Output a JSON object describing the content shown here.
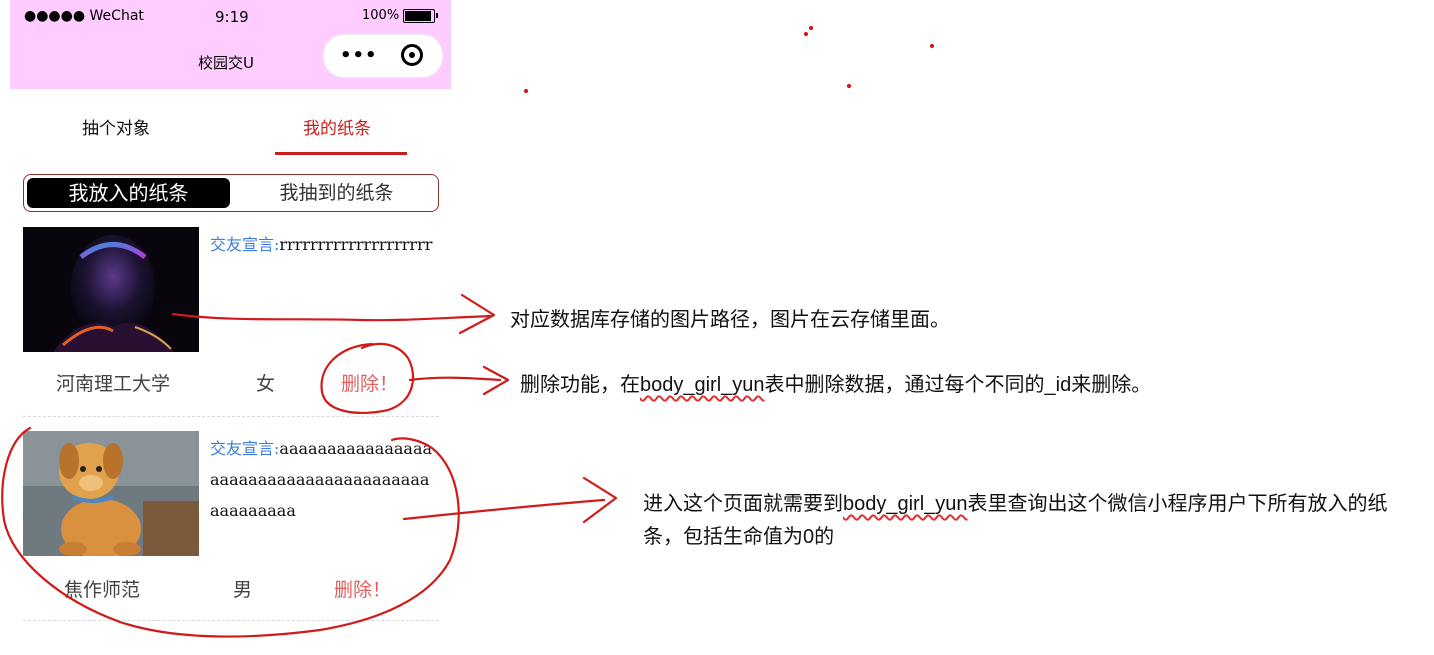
{
  "status": {
    "carrier": "●●●●● WeChat",
    "time": "9:19",
    "battery": "100%"
  },
  "nav": {
    "title": "校园交U",
    "more": "•••"
  },
  "tabs": [
    {
      "label": "抽个对象"
    },
    {
      "label": "我的纸条"
    }
  ],
  "segment": {
    "active": "我放入的纸条",
    "inactive": "我抽到的纸条"
  },
  "notes": [
    {
      "label": "交友宣言:",
      "text": "rrrrrrrrrrrrrrrrrrrr",
      "school": "河南理工大学",
      "gender": "女",
      "action": "删除！"
    },
    {
      "label": "交友宣言:",
      "text": "aaaaaaaaaaaaaaaaaaaaaaaaaaaaaaaaaaaaaaaaaaaaaaaa",
      "school": "焦作师范",
      "gender": "男",
      "action": "删除！"
    }
  ],
  "annotations": [
    {
      "text": "对应数据库存储的图片路径，图片在云存储里面。"
    },
    {
      "pre": "删除功能，在",
      "code": "body_girl_yun",
      "post": "表中删除数据，通过每个不同的_id来删除。"
    },
    {
      "pre": "进入这个页面就需要到",
      "code": "body_girl_yun",
      "post": "表里查询出这个微信小程序用户下所有放入的纸条，包括生命值为0的"
    }
  ],
  "colors": {
    "accent": "#c81e1e",
    "nav_bg": "#ffccff",
    "link": "#3b7dd8",
    "delete": "#e2615e",
    "ink": "#d11a1a"
  }
}
